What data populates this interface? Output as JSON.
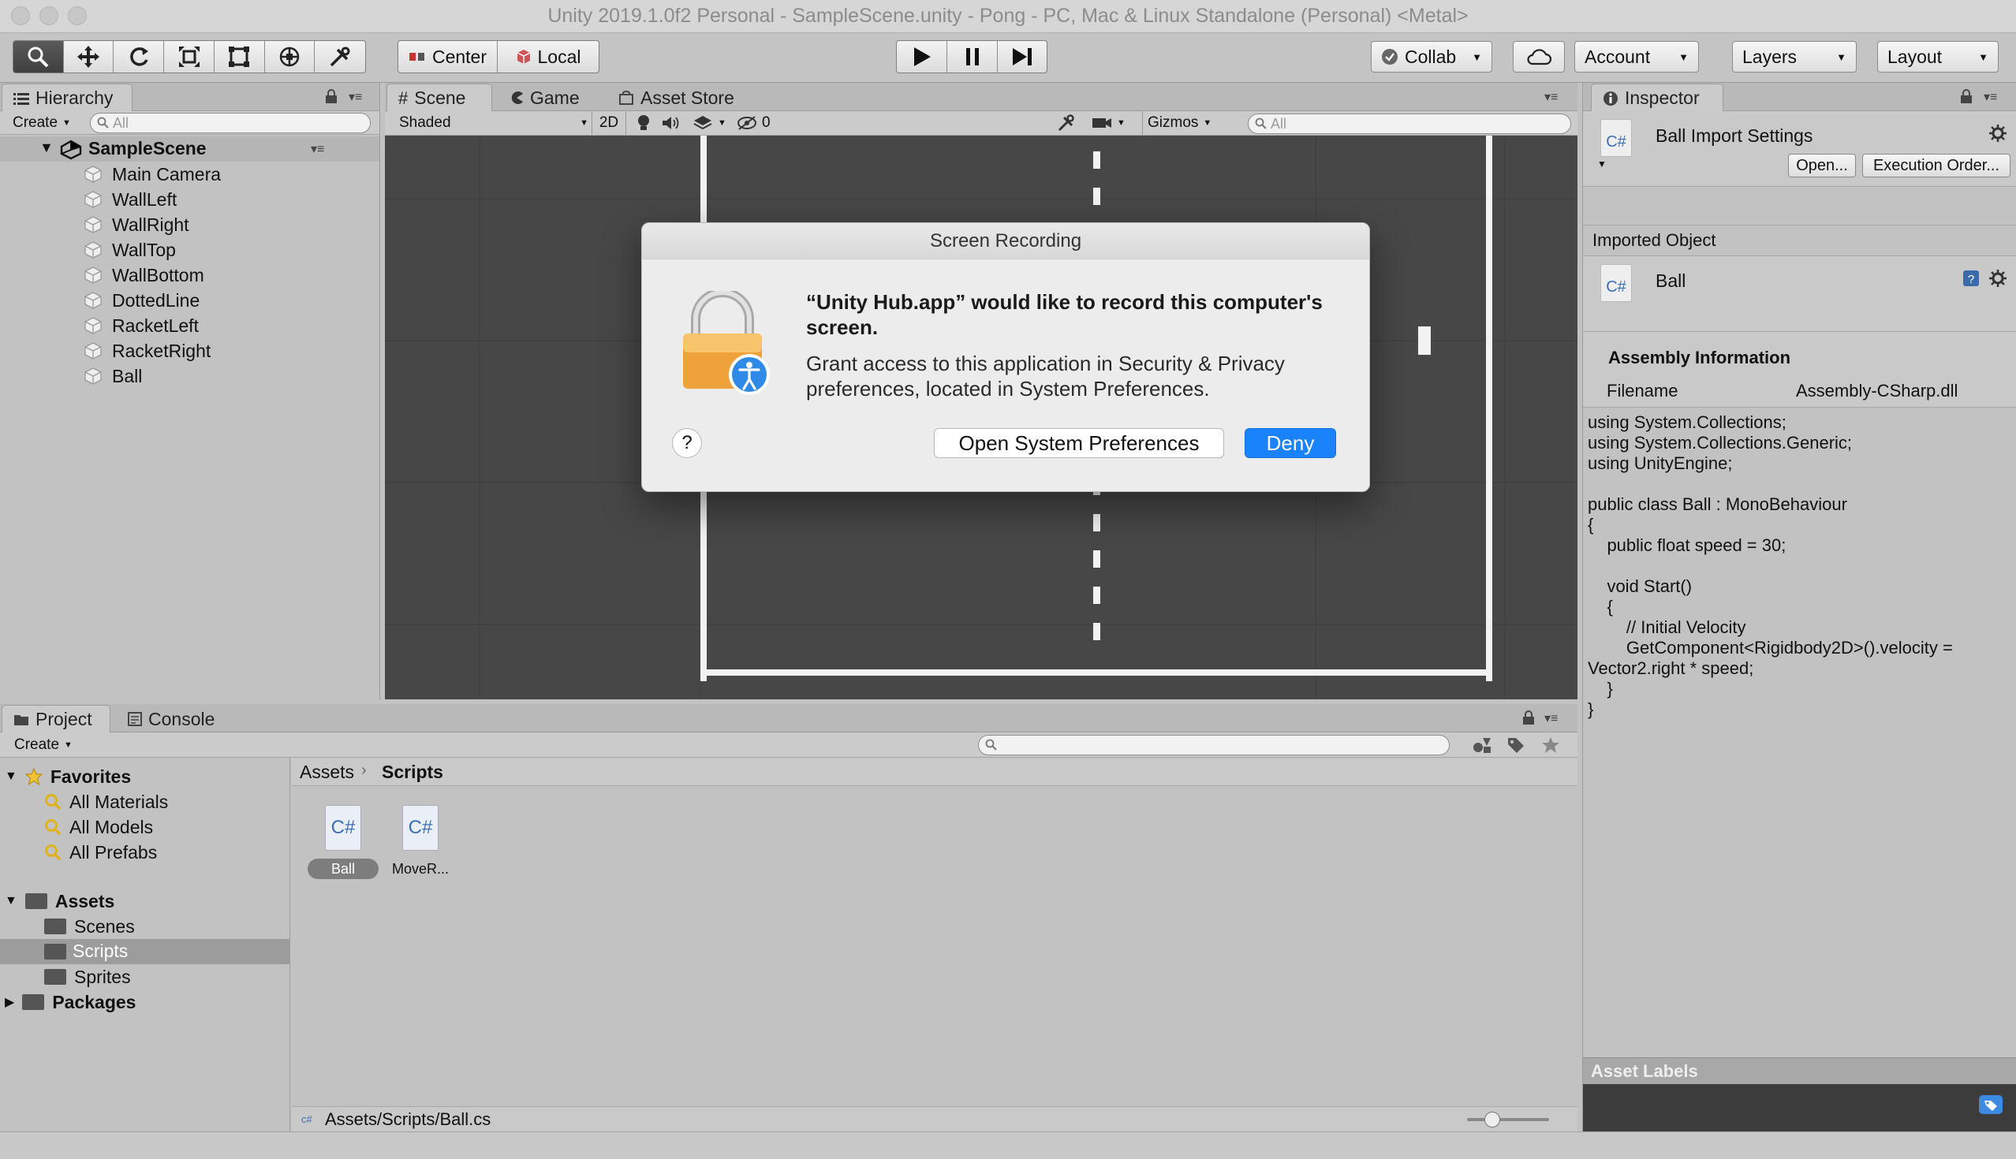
{
  "window": {
    "title": "Unity 2019.1.0f2 Personal - SampleScene.unity - Pong - PC, Mac & Linux Standalone (Personal) <Metal>"
  },
  "toolbar": {
    "pivot_label": "Center",
    "space_label": "Local",
    "collab_label": "Collab",
    "account_label": "Account",
    "layers_label": "Layers",
    "layout_label": "Layout"
  },
  "hierarchy": {
    "tab_label": "Hierarchy",
    "create_label": "Create",
    "search_placeholder": "All",
    "scene_name": "SampleScene",
    "items": [
      {
        "label": "Main Camera"
      },
      {
        "label": "WallLeft"
      },
      {
        "label": "WallRight"
      },
      {
        "label": "WallTop"
      },
      {
        "label": "WallBottom"
      },
      {
        "label": "DottedLine"
      },
      {
        "label": "RacketLeft"
      },
      {
        "label": "RacketRight"
      },
      {
        "label": "Ball"
      }
    ]
  },
  "scene_view": {
    "tabs": [
      {
        "label": "Scene"
      },
      {
        "label": "Game"
      },
      {
        "label": "Asset Store"
      }
    ],
    "shading_mode": "Shaded",
    "mode_2d_label": "2D",
    "hidden_count": "0",
    "gizmos_label": "Gizmos",
    "search_placeholder": "All"
  },
  "dialog": {
    "title": "Screen Recording",
    "heading": "“Unity Hub.app” would like to record this computer's screen.",
    "body": "Grant access to this application in Security & Privacy preferences, located in System Preferences.",
    "help_label": "?",
    "open_prefs_label": "Open System Preferences",
    "deny_label": "Deny",
    "accent_color": "#1a82fb"
  },
  "inspector": {
    "tab_label": "Inspector",
    "file_badge": "C#",
    "import_title": "Ball Import Settings",
    "open_label": "Open...",
    "execution_order_label": "Execution Order...",
    "imported_object_label": "Imported Object",
    "object_name": "Ball",
    "assembly_header": "Assembly Information",
    "filename_label": "Filename",
    "filename_value": "Assembly-CSharp.dll",
    "code": "using System.Collections;\nusing System.Collections.Generic;\nusing UnityEngine;\n\npublic class Ball : MonoBehaviour\n{\n    public float speed = 30;\n\n    void Start()\n    {\n        // Initial Velocity\n        GetComponent<Rigidbody2D>().velocity =\nVector2.right * speed;\n    }\n}",
    "asset_labels_header": "Asset Labels"
  },
  "project": {
    "tabs": [
      {
        "label": "Project"
      },
      {
        "label": "Console"
      }
    ],
    "create_label": "Create",
    "favorites_label": "Favorites",
    "favorites_items": [
      {
        "label": "All Materials"
      },
      {
        "label": "All Models"
      },
      {
        "label": "All Prefabs"
      }
    ],
    "assets_label": "Assets",
    "assets_items": [
      {
        "label": "Scenes"
      },
      {
        "label": "Scripts"
      },
      {
        "label": "Sprites"
      }
    ],
    "packages_label": "Packages",
    "breadcrumb_root": "Assets",
    "breadcrumb_current": "Scripts",
    "files": [
      {
        "label": "Ball",
        "badge": "C#"
      },
      {
        "label": "MoveR...",
        "badge": "C#"
      }
    ],
    "status_path": "Assets/Scripts/Ball.cs"
  }
}
